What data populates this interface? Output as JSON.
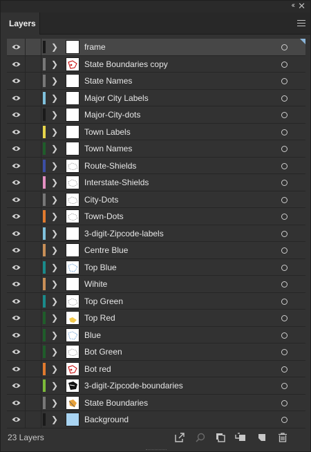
{
  "panel": {
    "title_tab": "Layers",
    "footer_count": "23 Layers"
  },
  "colors": {
    "selection": "#474747",
    "panel_bg": "#323232"
  },
  "layers": [
    {
      "name": "frame",
      "color": "#1a1a1a",
      "thumb": "white",
      "selected": true
    },
    {
      "name": "State Boundaries copy",
      "color": "#777777",
      "thumb": "red-map"
    },
    {
      "name": "State Names",
      "color": "#777777",
      "thumb": "white"
    },
    {
      "name": "Major City Labels",
      "color": "#7fc1dd",
      "thumb": "white"
    },
    {
      "name": "Major-City-dots",
      "color": "#1a1a1a",
      "thumb": "white"
    },
    {
      "name": "Town Labels",
      "color": "#e6d44a",
      "thumb": "white"
    },
    {
      "name": "Town Names",
      "color": "#1f5d2a",
      "thumb": "white"
    },
    {
      "name": "Route-Shields",
      "color": "#3c4ea4",
      "thumb": "gray-map"
    },
    {
      "name": "Interstate-Shields",
      "color": "#e490c2",
      "thumb": "gray-map"
    },
    {
      "name": "City-Dots",
      "color": "#777777",
      "thumb": "gray-map"
    },
    {
      "name": "Town-Dots",
      "color": "#e07a2e",
      "thumb": "gray-map"
    },
    {
      "name": "3-digit-Zipcode-labels",
      "color": "#7fc1dd",
      "thumb": "white"
    },
    {
      "name": "Centre Blue",
      "color": "#c88f57",
      "thumb": "white"
    },
    {
      "name": "Top Blue",
      "color": "#1a8b8b",
      "thumb": "blue-map"
    },
    {
      "name": "Wihite",
      "color": "#c88f57",
      "thumb": "white"
    },
    {
      "name": "Top Green",
      "color": "#1a8b8b",
      "thumb": "gray-map"
    },
    {
      "name": "Top Red",
      "color": "#1f5d2a",
      "thumb": "yellow-map"
    },
    {
      "name": "Blue",
      "color": "#1f5d2a",
      "thumb": "blue-map"
    },
    {
      "name": "Bot Green",
      "color": "#1f5d2a",
      "thumb": "gray-map"
    },
    {
      "name": "Bot red",
      "color": "#e07a2e",
      "thumb": "red-map"
    },
    {
      "name": "3-digit-Zipcode-boundaries",
      "color": "#7cba3a",
      "thumb": "black-map"
    },
    {
      "name": "State Boundaries",
      "color": "#777777",
      "thumb": "orange-map"
    },
    {
      "name": "Background",
      "color": "#1a1a1a",
      "thumb": "lightblue"
    }
  ],
  "icons": {
    "collapse": "double-chevron-left-icon",
    "close": "close-icon",
    "menu": "hamburger-menu-icon",
    "visibility": "eye-icon",
    "expand": "chevron-right-icon",
    "target": "target-circle-icon",
    "footer": [
      "export-icon",
      "locate-object-icon",
      "clipping-mask-icon",
      "new-sublayer-icon",
      "new-layer-icon",
      "delete-icon"
    ]
  }
}
